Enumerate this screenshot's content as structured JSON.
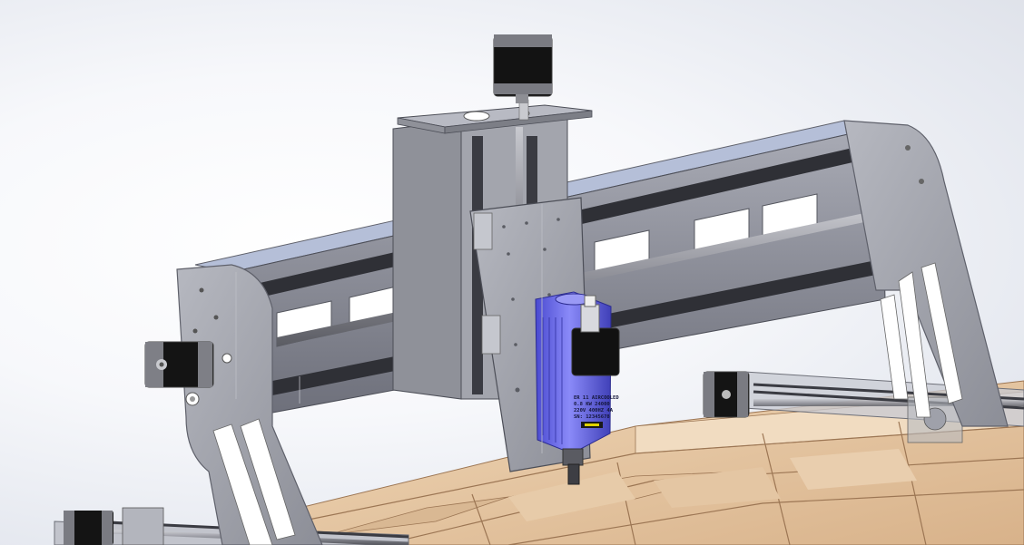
{
  "scene": {
    "subject": "cnc-router-gantry-cad-model",
    "colors": {
      "background_light": "#ffffff",
      "background_dark": "#dcdfe7",
      "aluminum": "#9a9ca4",
      "aluminum_dark": "#5f616b",
      "rail_dark": "#3a3b42",
      "spindle_blue": "#6f6ff0",
      "spindle_dark": "#3c3cc0",
      "motor_black": "#141414",
      "wood": "#e8c9a6",
      "wood_dark": "#c9a07a",
      "label_yellow": "#e0d200"
    },
    "spindle_label_lines": [
      "ER 11 AIRCOOLED",
      "0.8 KW 24000",
      "220V 400HZ 4A",
      "SN: 12345678"
    ]
  }
}
